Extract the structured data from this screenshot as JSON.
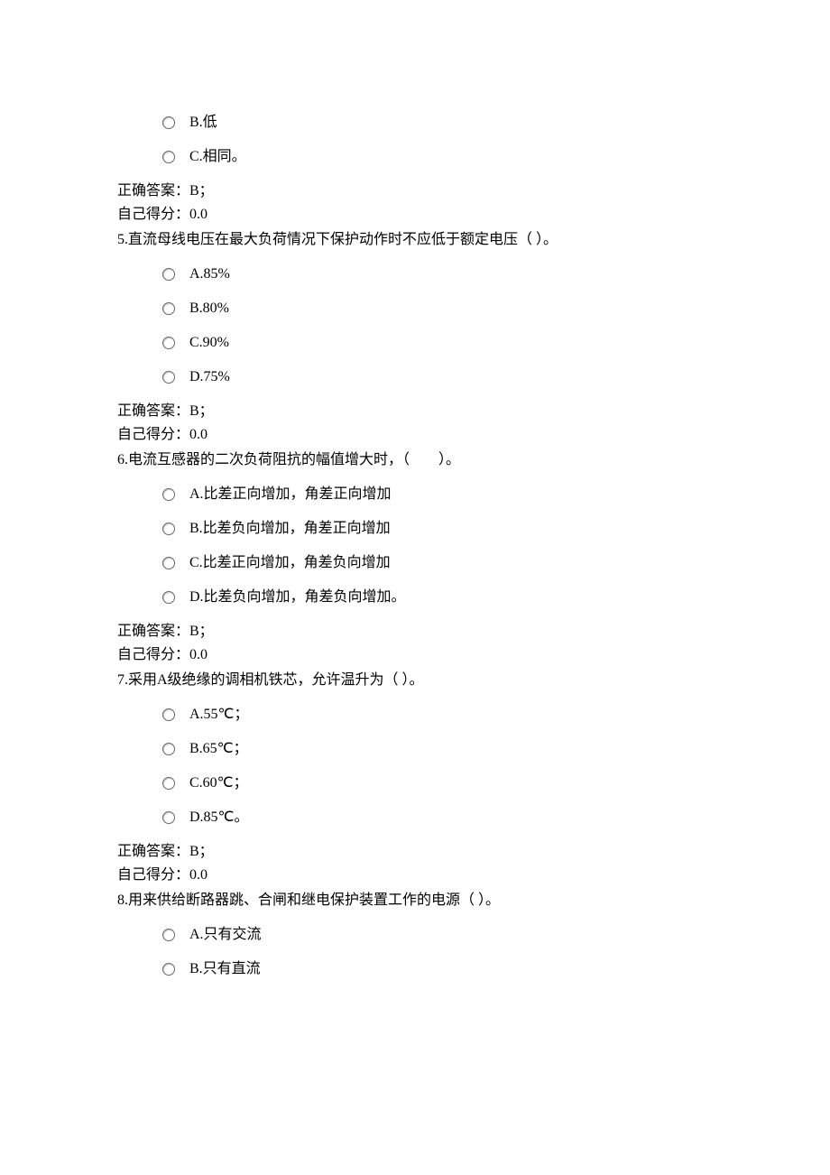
{
  "prequestion_options": [
    "B.低",
    "C.相同。"
  ],
  "blocks": [
    {
      "answer": "正确答案：B；",
      "score": "自己得分：0.0",
      "next_question": "5.直流母线电压在最大负荷情况下保护动作时不应低于额定电压（ ）。",
      "options": [
        "A.85%",
        "B.80%",
        "C.90%",
        "D.75%"
      ]
    },
    {
      "answer": "正确答案：B；",
      "score": "自己得分：0.0",
      "next_question": "6.电流互感器的二次负荷阻抗的幅值增大时，（　　）。",
      "options": [
        "A.比差正向增加，角差正向增加",
        "B.比差负向增加，角差正向增加",
        "C.比差正向增加，角差负向增加",
        "D.比差负向增加，角差负向增加。"
      ]
    },
    {
      "answer": "正确答案：B；",
      "score": "自己得分：0.0",
      "next_question": "7.采用A级绝缘的调相机铁芯，允许温升为（ ）。",
      "options": [
        "A.55℃；",
        "B.65℃；",
        "C.60℃；",
        "D.85℃。"
      ]
    },
    {
      "answer": "正确答案：B；",
      "score": "自己得分：0.0",
      "next_question": "8.用来供给断路器跳、合闸和继电保护装置工作的电源（ ）。",
      "options": [
        "A.只有交流",
        "B.只有直流"
      ]
    }
  ]
}
